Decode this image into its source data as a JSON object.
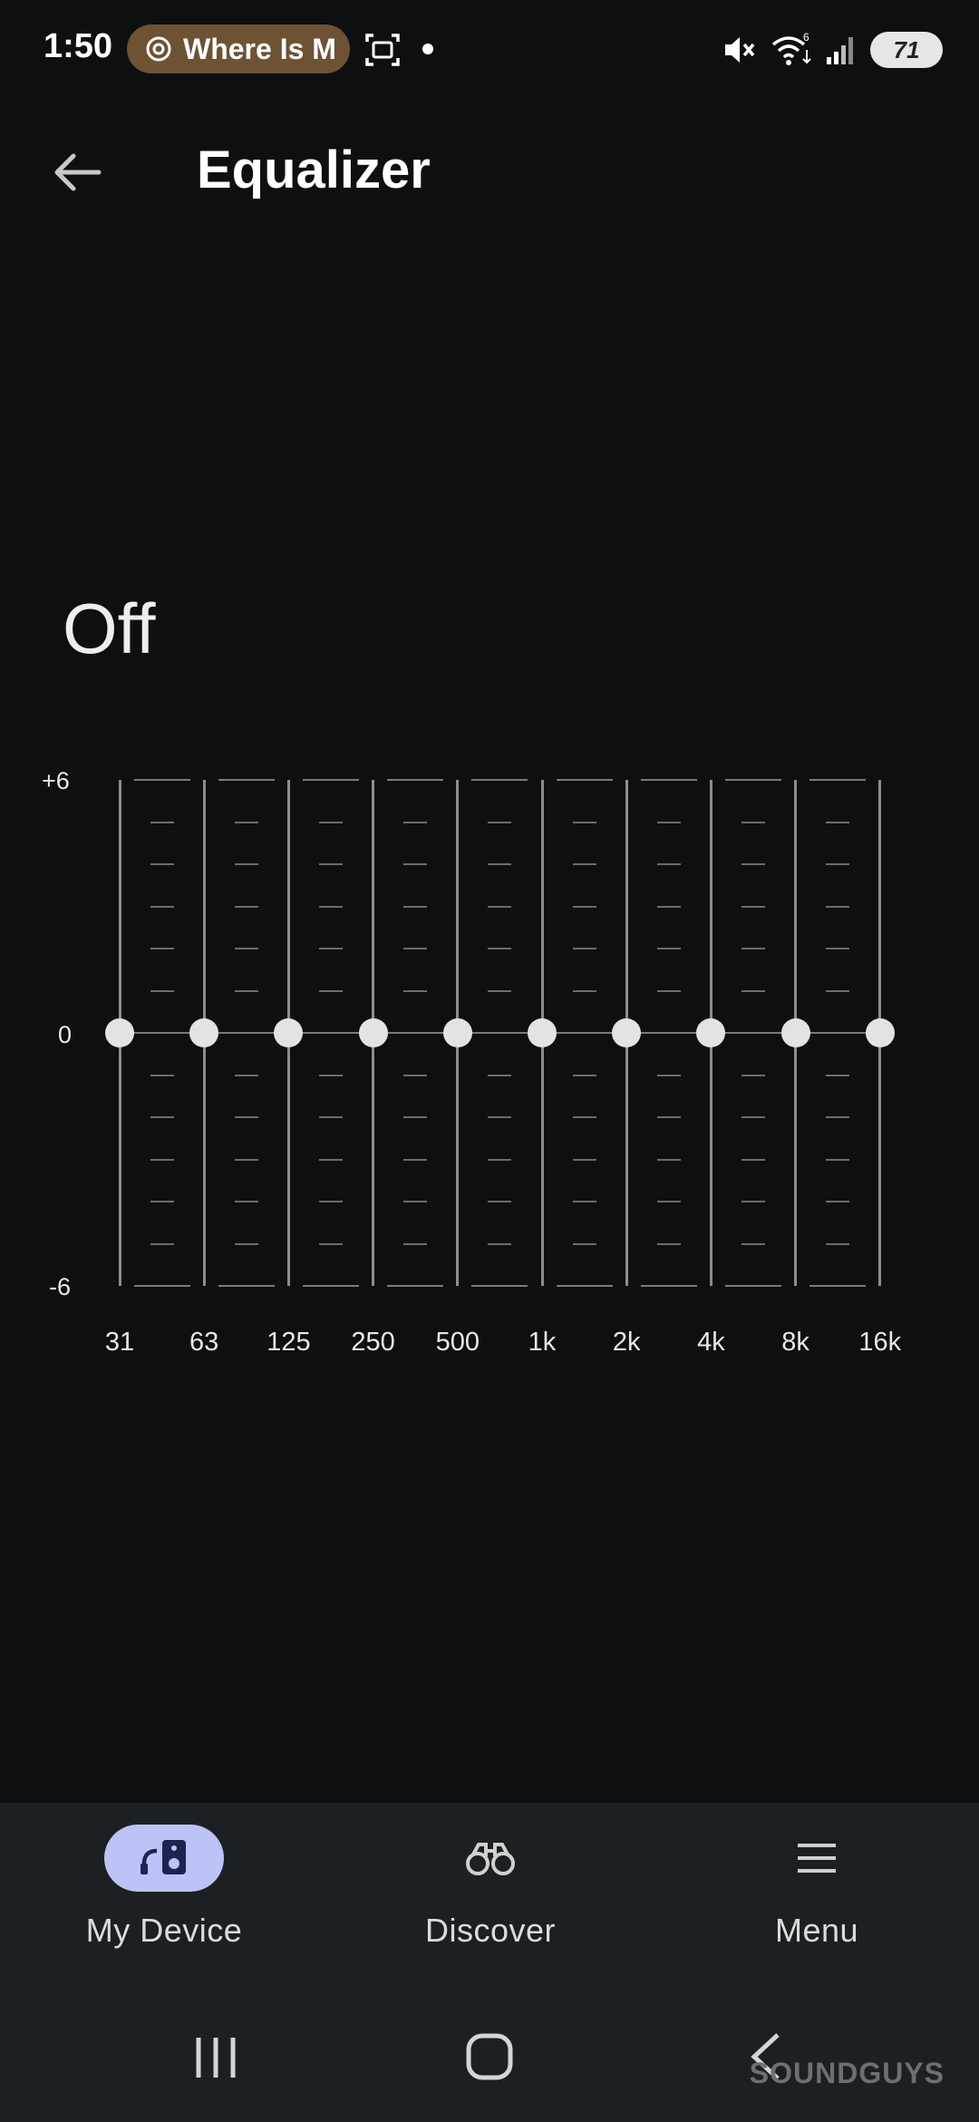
{
  "status_bar": {
    "time": "1:50",
    "notification_pill": "Where Is M",
    "battery": "71"
  },
  "header": {
    "title": "Equalizer"
  },
  "equalizer": {
    "state": "Off",
    "db_labels": {
      "top": "+6",
      "mid": "0",
      "bottom": "-6"
    },
    "bands": [
      {
        "label": "31",
        "gain": 0
      },
      {
        "label": "63",
        "gain": 0
      },
      {
        "label": "125",
        "gain": 0
      },
      {
        "label": "250",
        "gain": 0
      },
      {
        "label": "500",
        "gain": 0
      },
      {
        "label": "1k",
        "gain": 0
      },
      {
        "label": "2k",
        "gain": 0
      },
      {
        "label": "4k",
        "gain": 0
      },
      {
        "label": "8k",
        "gain": 0
      },
      {
        "label": "16k",
        "gain": 0
      }
    ],
    "gain_range": [
      -6,
      6
    ]
  },
  "bottom_nav": {
    "items": [
      {
        "label": "My Device",
        "icon": "headphones-speaker-icon",
        "active": true
      },
      {
        "label": "Discover",
        "icon": "binoculars-icon",
        "active": false
      },
      {
        "label": "Menu",
        "icon": "hamburger-menu-icon",
        "active": false
      }
    ]
  },
  "watermark": "SOUNDGUYS",
  "colors": {
    "background": "#0e0f10",
    "nav_background": "#1d2022",
    "active_nav_pill": "#bdc3f7",
    "pill_notification": "#6e5234"
  }
}
